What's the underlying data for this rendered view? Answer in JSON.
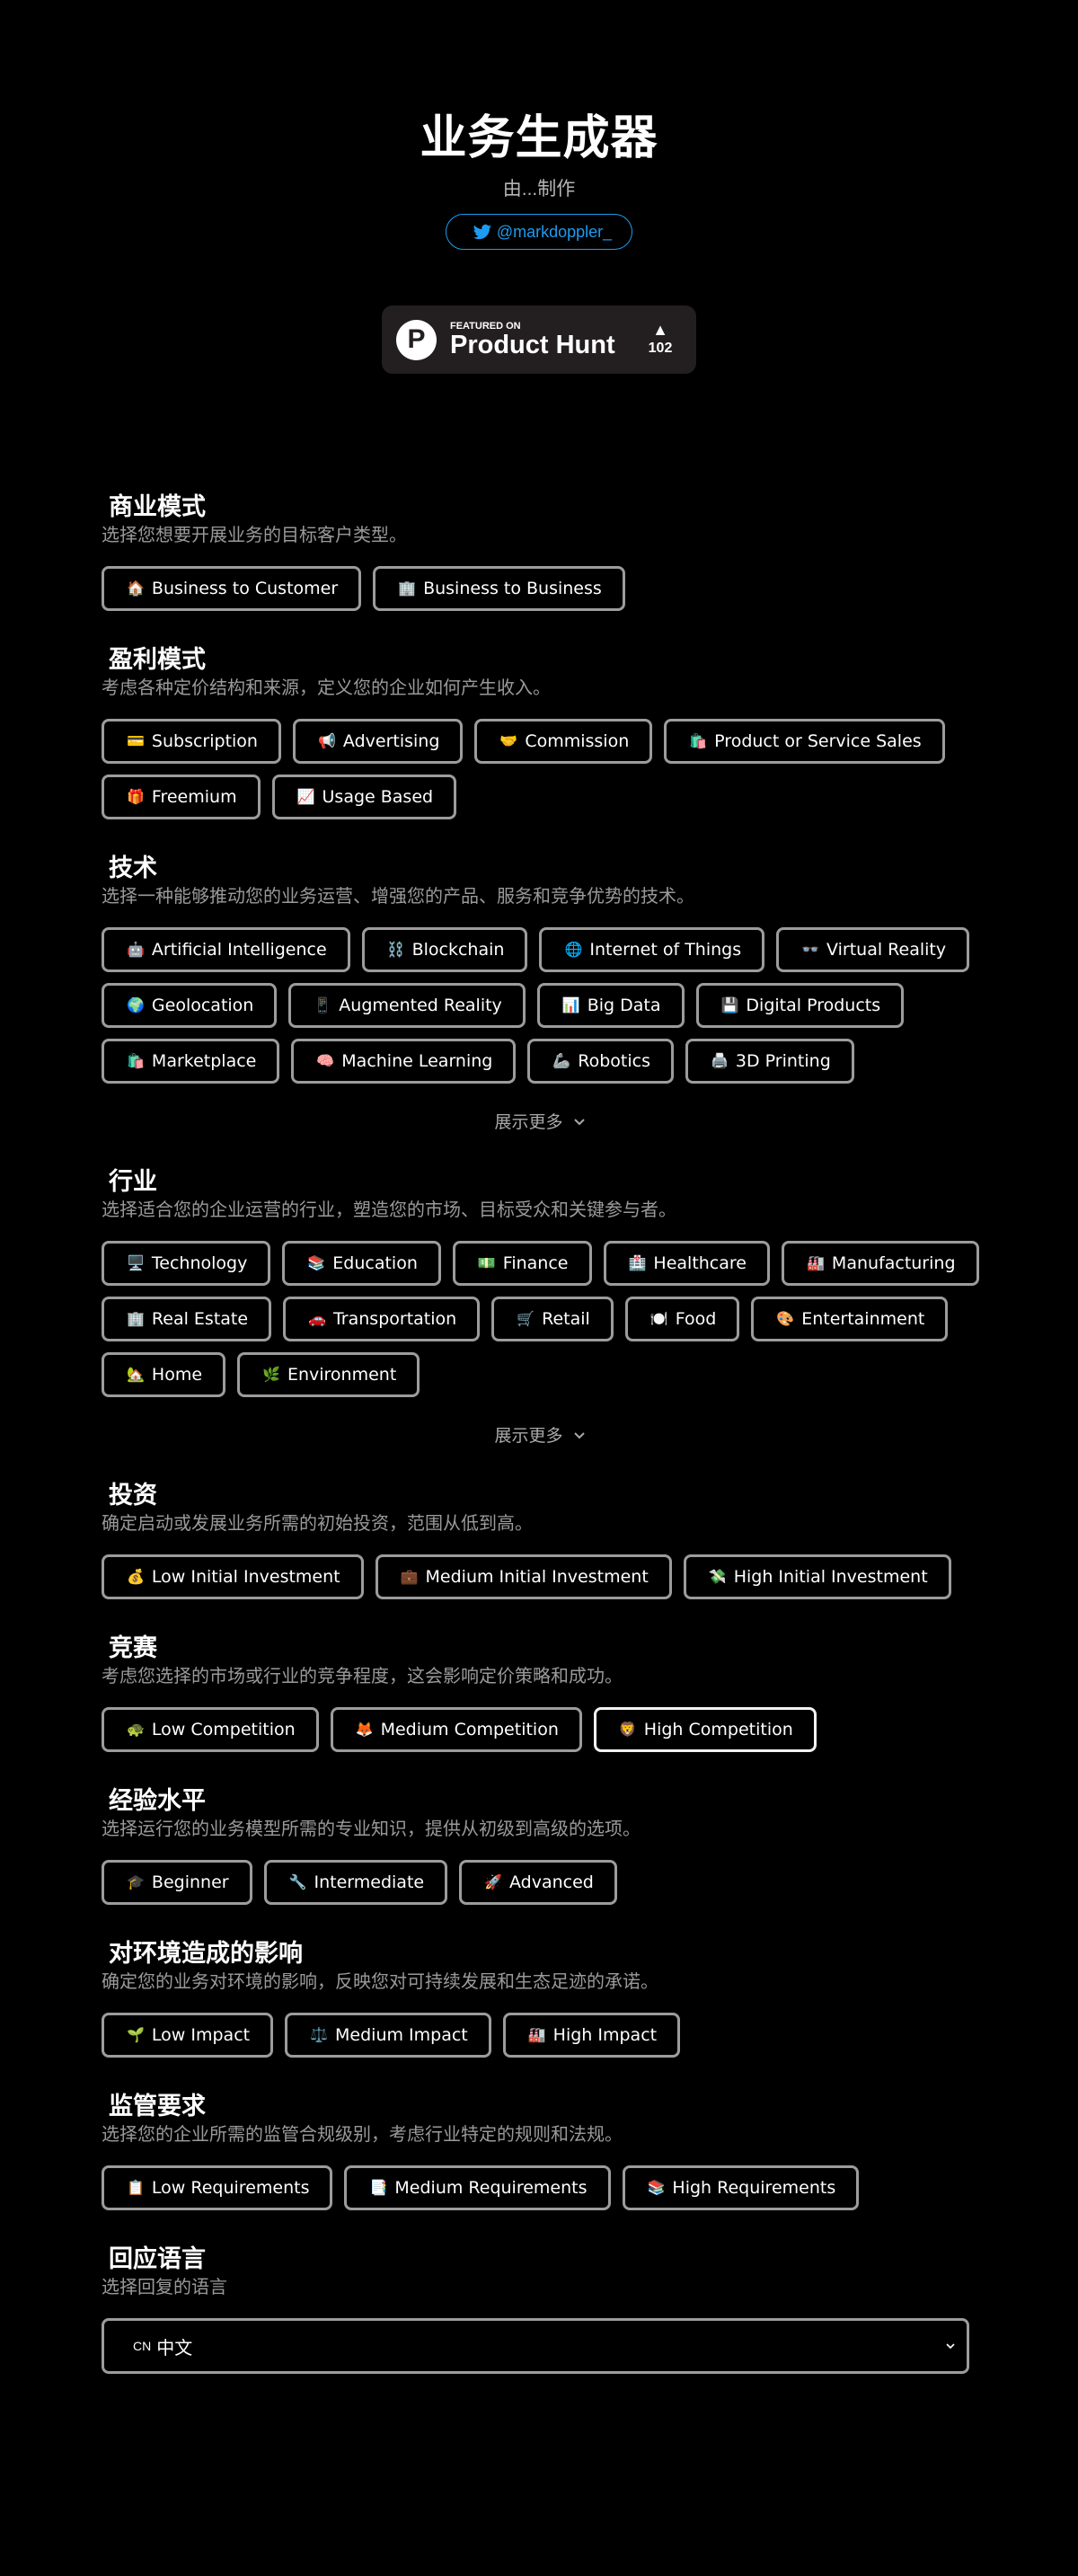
{
  "header": {
    "title": "业务生成器",
    "made_by": "由...制作",
    "twitter_handle": "@markdoppler_",
    "product_hunt": {
      "featured_label": "FEATURED ON",
      "name": "Product Hunt",
      "logo_letter": "P",
      "upvote_arrow": "▲",
      "votes": "102"
    }
  },
  "colors": {
    "background": "#000000",
    "twitter_blue": "#1d9bf0",
    "button_border": "#9c9c9c",
    "button_border_hover": "#f2f2f2",
    "description_text": "#9a9a9a"
  },
  "sections": [
    {
      "id": "business-model",
      "title": "商业模式",
      "description": "选择您想要开展业务的目标客户类型。",
      "options": [
        {
          "icon": "🏠",
          "icon_name": "house-icon",
          "label": "Business to Customer"
        },
        {
          "icon": "🏢",
          "icon_name": "office-building-icon",
          "label": "Business to Business"
        }
      ]
    },
    {
      "id": "revenue-model",
      "title": "盈利模式",
      "description": "考虑各种定价结构和来源，定义您的企业如何产生收入。",
      "options": [
        {
          "icon": "💳",
          "icon_name": "credit-card-icon",
          "label": "Subscription"
        },
        {
          "icon": "📢",
          "icon_name": "megaphone-icon",
          "label": "Advertising"
        },
        {
          "icon": "🤝",
          "icon_name": "handshake-icon",
          "label": "Commission"
        },
        {
          "icon": "🛍️",
          "icon_name": "shopping-bags-icon",
          "label": "Product or Service Sales"
        },
        {
          "icon": "🎁",
          "icon_name": "gift-icon",
          "label": "Freemium"
        },
        {
          "icon": "📈",
          "icon_name": "chart-increasing-icon",
          "label": "Usage Based"
        }
      ]
    },
    {
      "id": "technology",
      "title": "技术",
      "description": "选择一种能够推动您的业务运营、增强您的产品、服务和竞争优势的技术。",
      "options": [
        {
          "icon": "🤖",
          "icon_name": "robot-icon",
          "label": "Artificial Intelligence"
        },
        {
          "icon": "⛓️",
          "icon_name": "chains-icon",
          "label": "Blockchain"
        },
        {
          "icon": "🌐",
          "icon_name": "globe-meridians-icon",
          "label": "Internet of Things"
        },
        {
          "icon": "👓",
          "icon_name": "glasses-icon",
          "label": "Virtual Reality"
        },
        {
          "icon": "🌍",
          "icon_name": "globe-icon",
          "label": "Geolocation"
        },
        {
          "icon": "📱",
          "icon_name": "mobile-phone-icon",
          "label": "Augmented Reality"
        },
        {
          "icon": "📊",
          "icon_name": "bar-chart-icon",
          "label": "Big Data"
        },
        {
          "icon": "💾",
          "icon_name": "floppy-disk-icon",
          "label": "Digital Products"
        },
        {
          "icon": "🛍️",
          "icon_name": "shopping-bags-icon",
          "label": "Marketplace"
        },
        {
          "icon": "🧠",
          "icon_name": "brain-icon",
          "label": "Machine Learning"
        },
        {
          "icon": "🦾",
          "icon_name": "mechanical-arm-icon",
          "label": "Robotics"
        },
        {
          "icon": "🖨️",
          "icon_name": "printer-icon",
          "label": "3D Printing"
        }
      ],
      "show_more": "展示更多"
    },
    {
      "id": "industry",
      "title": "行业",
      "description": "选择适合您的企业运营的行业，塑造您的市场、目标受众和关键参与者。",
      "options": [
        {
          "icon": "🖥️",
          "icon_name": "desktop-computer-icon",
          "label": "Technology"
        },
        {
          "icon": "📚",
          "icon_name": "books-icon",
          "label": "Education"
        },
        {
          "icon": "💵",
          "icon_name": "banknote-icon",
          "label": "Finance"
        },
        {
          "icon": "🏥",
          "icon_name": "hospital-icon",
          "label": "Healthcare"
        },
        {
          "icon": "🏭",
          "icon_name": "factory-icon",
          "label": "Manufacturing"
        },
        {
          "icon": "🏢",
          "icon_name": "office-building-icon",
          "label": "Real Estate"
        },
        {
          "icon": "🚗",
          "icon_name": "car-icon",
          "label": "Transportation"
        },
        {
          "icon": "🛒",
          "icon_name": "shopping-cart-icon",
          "label": "Retail"
        },
        {
          "icon": "🍽️",
          "icon_name": "plate-cutlery-icon",
          "label": "Food"
        },
        {
          "icon": "🎨",
          "icon_name": "palette-icon",
          "label": "Entertainment"
        },
        {
          "icon": "🏡",
          "icon_name": "house-garden-icon",
          "label": "Home"
        },
        {
          "icon": "🌿",
          "icon_name": "herb-icon",
          "label": "Environment"
        }
      ],
      "show_more": "展示更多"
    },
    {
      "id": "investment",
      "title": "投资",
      "description": "确定启动或发展业务所需的初始投资，范围从低到高。",
      "options": [
        {
          "icon": "💰",
          "icon_name": "money-bag-icon",
          "label": "Low Initial Investment"
        },
        {
          "icon": "💼",
          "icon_name": "briefcase-icon",
          "label": "Medium Initial Investment"
        },
        {
          "icon": "💸",
          "icon_name": "money-wings-icon",
          "label": "High Initial Investment"
        }
      ]
    },
    {
      "id": "competition",
      "title": "竞赛",
      "description": "考虑您选择的市场或行业的竞争程度，这会影响定价策略和成功。",
      "options": [
        {
          "icon": "🐢",
          "icon_name": "turtle-icon",
          "label": "Low Competition"
        },
        {
          "icon": "🦊",
          "icon_name": "fox-icon",
          "label": "Medium Competition"
        },
        {
          "icon": "🦁",
          "icon_name": "lion-icon",
          "label": "High Competition",
          "hover": true
        }
      ]
    },
    {
      "id": "experience",
      "title": "经验水平",
      "description": "选择运行您的业务模型所需的专业知识，提供从初级到高级的选项。",
      "options": [
        {
          "icon": "🎓",
          "icon_name": "graduation-cap-icon",
          "label": "Beginner"
        },
        {
          "icon": "🔧",
          "icon_name": "wrench-icon",
          "label": "Intermediate"
        },
        {
          "icon": "🚀",
          "icon_name": "rocket-icon",
          "label": "Advanced"
        }
      ]
    },
    {
      "id": "environmental-impact",
      "title": "对环境造成的影响",
      "description": "确定您的业务对环境的影响，反映您对可持续发展和生态足迹的承诺。",
      "options": [
        {
          "icon": "🌱",
          "icon_name": "seedling-icon",
          "label": "Low Impact"
        },
        {
          "icon": "⚖️",
          "icon_name": "balance-scale-icon",
          "label": "Medium Impact"
        },
        {
          "icon": "🏭",
          "icon_name": "factory-icon",
          "label": "High Impact"
        }
      ]
    },
    {
      "id": "regulatory",
      "title": "监管要求",
      "description": "选择您的企业所需的监管合规级别，考虑行业特定的规则和法规。",
      "options": [
        {
          "icon": "📋",
          "icon_name": "clipboard-icon",
          "label": "Low Requirements"
        },
        {
          "icon": "📑",
          "icon_name": "bookmark-tabs-icon",
          "label": "Medium Requirements"
        },
        {
          "icon": "📚",
          "icon_name": "books-icon",
          "label": "High Requirements"
        }
      ]
    }
  ],
  "language": {
    "title": "回应语言",
    "description": "选择回复的语言",
    "selected_code": "CN",
    "selected_label": "中文"
  }
}
